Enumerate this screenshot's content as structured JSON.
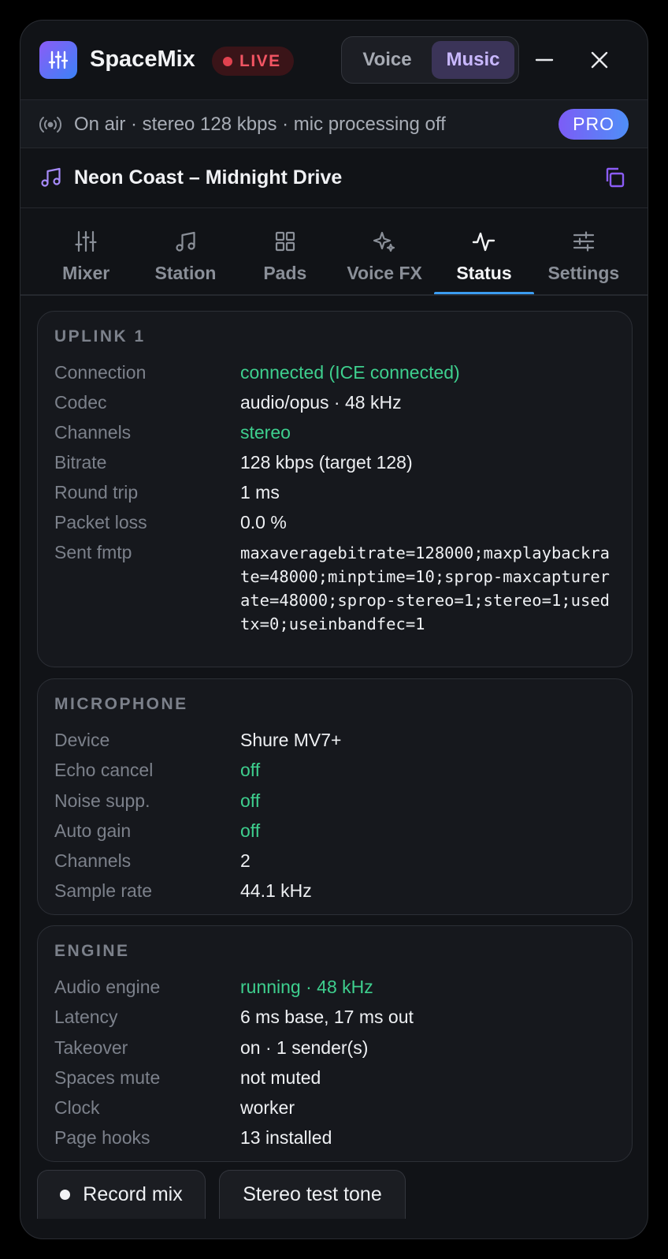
{
  "header": {
    "title": "SpaceMix",
    "live_badge": "LIVE",
    "mode_switch": {
      "voice": "Voice",
      "music": "Music",
      "selected": "Music"
    },
    "icons": [
      "sliders-icon",
      "minimize-icon",
      "close-icon"
    ]
  },
  "status_bar": {
    "text": "On air · stereo 128 kbps · mic processing off",
    "pro_badge": "PRO",
    "icon": "broadcast-icon"
  },
  "now_playing": {
    "title": "Neon Coast – Midnight Drive",
    "icon": "music-note-icon",
    "action_icon": "copy-icon"
  },
  "tabs": [
    {
      "label": "Mixer",
      "icon": "sliders-icon",
      "active": false
    },
    {
      "label": "Station",
      "icon": "music-note-icon",
      "active": false
    },
    {
      "label": "Pads",
      "icon": "grid-icon",
      "active": false
    },
    {
      "label": "Voice FX",
      "icon": "sparkles-icon",
      "active": false
    },
    {
      "label": "Status",
      "icon": "activity-icon",
      "active": true
    },
    {
      "label": "Settings",
      "icon": "settings-sliders-icon",
      "active": false
    }
  ],
  "uplink": {
    "title": "UPLINK 1",
    "rows": [
      {
        "key": "Connection",
        "value": "connected (ICE connected)"
      },
      {
        "key": "Codec",
        "value": "audio/opus · 48 kHz"
      },
      {
        "key": "Channels",
        "value": "stereo"
      },
      {
        "key": "Bitrate",
        "value": "128 kbps (target 128)"
      },
      {
        "key": "Round trip",
        "value": "1 ms"
      },
      {
        "key": "Packet loss",
        "value": "0.0 %"
      },
      {
        "key": "Sent fmtp",
        "value": "maxaveragebitrate=128000;maxplaybackrate=48000;minptime=10;sprop-maxcapturerate=48000;sprop-stereo=1;stereo=1;usedtx=0;useinbandfec=1"
      }
    ]
  },
  "microphone": {
    "title": "MICROPHONE",
    "rows": [
      {
        "key": "Device",
        "value": "Shure MV7+"
      },
      {
        "key": "Echo cancel",
        "value": "off"
      },
      {
        "key": "Noise supp.",
        "value": "off"
      },
      {
        "key": "Auto gain",
        "value": "off"
      },
      {
        "key": "Channels",
        "value": "2"
      },
      {
        "key": "Sample rate",
        "value": "44.1 kHz"
      }
    ]
  },
  "engine": {
    "title": "ENGINE",
    "rows": [
      {
        "key": "Audio engine",
        "value": "running · 48 kHz"
      },
      {
        "key": "Latency",
        "value": "6 ms base, 17 ms out"
      },
      {
        "key": "Takeover",
        "value": "on · 1 sender(s)"
      },
      {
        "key": "Spaces mute",
        "value": "not muted"
      },
      {
        "key": "Clock",
        "value": "worker"
      },
      {
        "key": "Page hooks",
        "value": "13 installed"
      }
    ]
  },
  "footer": {
    "record_button": "Record mix",
    "test_tone_button": "Stereo test tone"
  },
  "colors": {
    "accent_blue": "#3b9cf0",
    "ok_green": "#3ecf8e",
    "live_red": "#e0424f",
    "music_purple": "#8b5cf6"
  }
}
